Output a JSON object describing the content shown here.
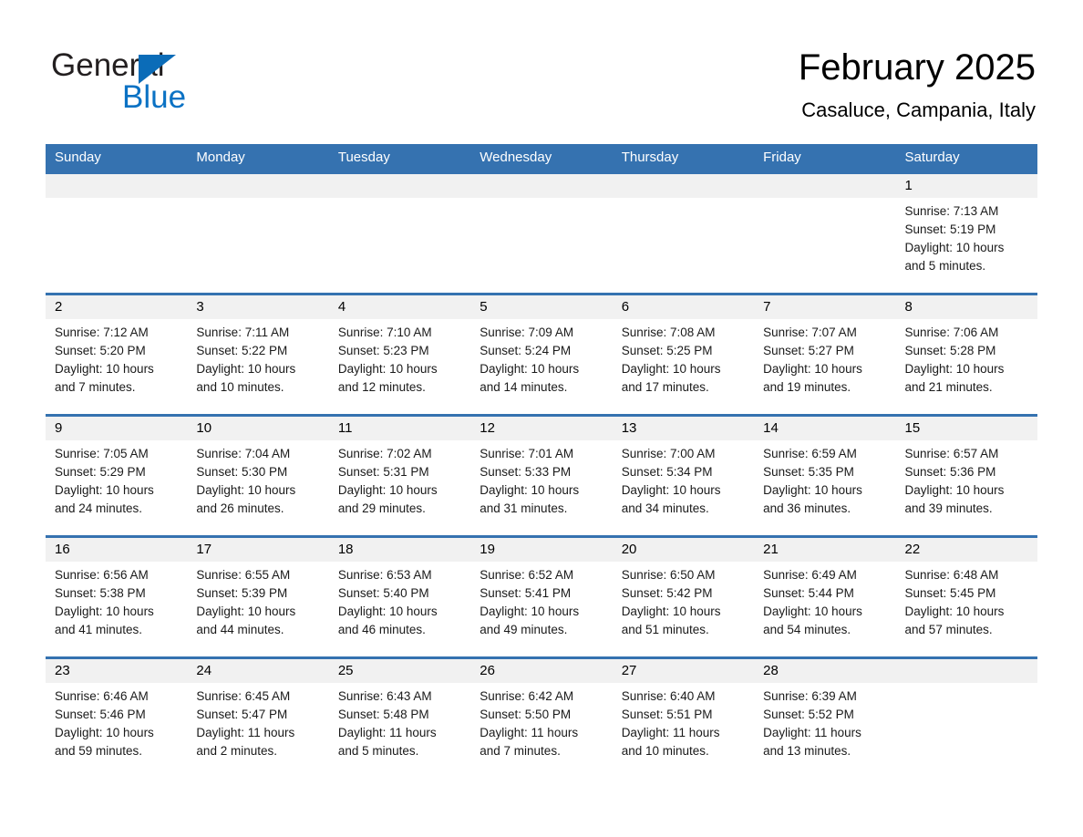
{
  "brand": {
    "name_part1": "General",
    "name_part2": "Blue",
    "accent_color": "#0b72c4",
    "logo_icon": "triangle-icon"
  },
  "header": {
    "title": "February 2025",
    "subtitle": "Casaluce, Campania, Italy"
  },
  "theme": {
    "header_bar_color": "#3572b0",
    "day_band_color": "#f1f1f1",
    "text_color": "#000000"
  },
  "labels": {
    "sunrise_prefix": "Sunrise:",
    "sunset_prefix": "Sunset:",
    "daylight_prefix": "Daylight:"
  },
  "weekdays": [
    "Sunday",
    "Monday",
    "Tuesday",
    "Wednesday",
    "Thursday",
    "Friday",
    "Saturday"
  ],
  "weeks": [
    [
      {
        "day": "",
        "sunrise": "",
        "sunset": "",
        "daylight": ""
      },
      {
        "day": "",
        "sunrise": "",
        "sunset": "",
        "daylight": ""
      },
      {
        "day": "",
        "sunrise": "",
        "sunset": "",
        "daylight": ""
      },
      {
        "day": "",
        "sunrise": "",
        "sunset": "",
        "daylight": ""
      },
      {
        "day": "",
        "sunrise": "",
        "sunset": "",
        "daylight": ""
      },
      {
        "day": "",
        "sunrise": "",
        "sunset": "",
        "daylight": ""
      },
      {
        "day": "1",
        "sunrise": "Sunrise: 7:13 AM",
        "sunset": "Sunset: 5:19 PM",
        "daylight": "Daylight: 10 hours and 5 minutes."
      }
    ],
    [
      {
        "day": "2",
        "sunrise": "Sunrise: 7:12 AM",
        "sunset": "Sunset: 5:20 PM",
        "daylight": "Daylight: 10 hours and 7 minutes."
      },
      {
        "day": "3",
        "sunrise": "Sunrise: 7:11 AM",
        "sunset": "Sunset: 5:22 PM",
        "daylight": "Daylight: 10 hours and 10 minutes."
      },
      {
        "day": "4",
        "sunrise": "Sunrise: 7:10 AM",
        "sunset": "Sunset: 5:23 PM",
        "daylight": "Daylight: 10 hours and 12 minutes."
      },
      {
        "day": "5",
        "sunrise": "Sunrise: 7:09 AM",
        "sunset": "Sunset: 5:24 PM",
        "daylight": "Daylight: 10 hours and 14 minutes."
      },
      {
        "day": "6",
        "sunrise": "Sunrise: 7:08 AM",
        "sunset": "Sunset: 5:25 PM",
        "daylight": "Daylight: 10 hours and 17 minutes."
      },
      {
        "day": "7",
        "sunrise": "Sunrise: 7:07 AM",
        "sunset": "Sunset: 5:27 PM",
        "daylight": "Daylight: 10 hours and 19 minutes."
      },
      {
        "day": "8",
        "sunrise": "Sunrise: 7:06 AM",
        "sunset": "Sunset: 5:28 PM",
        "daylight": "Daylight: 10 hours and 21 minutes."
      }
    ],
    [
      {
        "day": "9",
        "sunrise": "Sunrise: 7:05 AM",
        "sunset": "Sunset: 5:29 PM",
        "daylight": "Daylight: 10 hours and 24 minutes."
      },
      {
        "day": "10",
        "sunrise": "Sunrise: 7:04 AM",
        "sunset": "Sunset: 5:30 PM",
        "daylight": "Daylight: 10 hours and 26 minutes."
      },
      {
        "day": "11",
        "sunrise": "Sunrise: 7:02 AM",
        "sunset": "Sunset: 5:31 PM",
        "daylight": "Daylight: 10 hours and 29 minutes."
      },
      {
        "day": "12",
        "sunrise": "Sunrise: 7:01 AM",
        "sunset": "Sunset: 5:33 PM",
        "daylight": "Daylight: 10 hours and 31 minutes."
      },
      {
        "day": "13",
        "sunrise": "Sunrise: 7:00 AM",
        "sunset": "Sunset: 5:34 PM",
        "daylight": "Daylight: 10 hours and 34 minutes."
      },
      {
        "day": "14",
        "sunrise": "Sunrise: 6:59 AM",
        "sunset": "Sunset: 5:35 PM",
        "daylight": "Daylight: 10 hours and 36 minutes."
      },
      {
        "day": "15",
        "sunrise": "Sunrise: 6:57 AM",
        "sunset": "Sunset: 5:36 PM",
        "daylight": "Daylight: 10 hours and 39 minutes."
      }
    ],
    [
      {
        "day": "16",
        "sunrise": "Sunrise: 6:56 AM",
        "sunset": "Sunset: 5:38 PM",
        "daylight": "Daylight: 10 hours and 41 minutes."
      },
      {
        "day": "17",
        "sunrise": "Sunrise: 6:55 AM",
        "sunset": "Sunset: 5:39 PM",
        "daylight": "Daylight: 10 hours and 44 minutes."
      },
      {
        "day": "18",
        "sunrise": "Sunrise: 6:53 AM",
        "sunset": "Sunset: 5:40 PM",
        "daylight": "Daylight: 10 hours and 46 minutes."
      },
      {
        "day": "19",
        "sunrise": "Sunrise: 6:52 AM",
        "sunset": "Sunset: 5:41 PM",
        "daylight": "Daylight: 10 hours and 49 minutes."
      },
      {
        "day": "20",
        "sunrise": "Sunrise: 6:50 AM",
        "sunset": "Sunset: 5:42 PM",
        "daylight": "Daylight: 10 hours and 51 minutes."
      },
      {
        "day": "21",
        "sunrise": "Sunrise: 6:49 AM",
        "sunset": "Sunset: 5:44 PM",
        "daylight": "Daylight: 10 hours and 54 minutes."
      },
      {
        "day": "22",
        "sunrise": "Sunrise: 6:48 AM",
        "sunset": "Sunset: 5:45 PM",
        "daylight": "Daylight: 10 hours and 57 minutes."
      }
    ],
    [
      {
        "day": "23",
        "sunrise": "Sunrise: 6:46 AM",
        "sunset": "Sunset: 5:46 PM",
        "daylight": "Daylight: 10 hours and 59 minutes."
      },
      {
        "day": "24",
        "sunrise": "Sunrise: 6:45 AM",
        "sunset": "Sunset: 5:47 PM",
        "daylight": "Daylight: 11 hours and 2 minutes."
      },
      {
        "day": "25",
        "sunrise": "Sunrise: 6:43 AM",
        "sunset": "Sunset: 5:48 PM",
        "daylight": "Daylight: 11 hours and 5 minutes."
      },
      {
        "day": "26",
        "sunrise": "Sunrise: 6:42 AM",
        "sunset": "Sunset: 5:50 PM",
        "daylight": "Daylight: 11 hours and 7 minutes."
      },
      {
        "day": "27",
        "sunrise": "Sunrise: 6:40 AM",
        "sunset": "Sunset: 5:51 PM",
        "daylight": "Daylight: 11 hours and 10 minutes."
      },
      {
        "day": "28",
        "sunrise": "Sunrise: 6:39 AM",
        "sunset": "Sunset: 5:52 PM",
        "daylight": "Daylight: 11 hours and 13 minutes."
      },
      {
        "day": "",
        "sunrise": "",
        "sunset": "",
        "daylight": ""
      }
    ]
  ]
}
